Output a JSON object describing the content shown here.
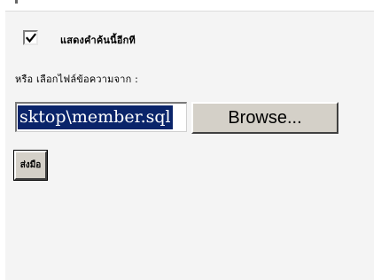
{
  "import_options": {
    "checkbox_checked": true,
    "checkbox_label": "แสดงคำค้นนี้อีกที",
    "file_label": "หรือ เลือกไฟล์ข้อความจาก :",
    "file_path": "sktop\\member.sql",
    "browse_label": "Browse...",
    "submit_label": "ส่งมือ"
  }
}
